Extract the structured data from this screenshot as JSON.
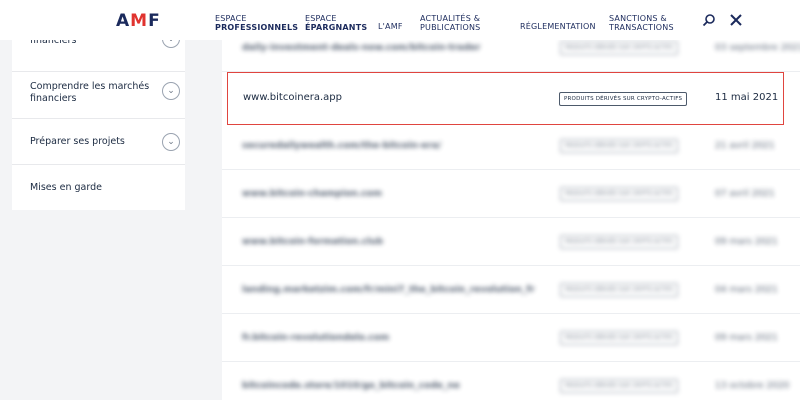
{
  "header": {
    "logo": "AMF",
    "nav": [
      {
        "line1": "ESPACE",
        "line2": "PROFESSIONNELS"
      },
      {
        "line1": "ESPACE",
        "line2": "ÉPARGNANTS"
      },
      {
        "line1": "L'AMF",
        "line2": ""
      },
      {
        "line1": "ACTUALITÉS &",
        "line2": "PUBLICATIONS"
      },
      {
        "line1": "RÉGLEMENTATION",
        "line2": ""
      },
      {
        "line1": "SANCTIONS &",
        "line2": "TRANSACTIONS"
      }
    ],
    "icons": [
      "search-icon",
      "close-icon"
    ]
  },
  "sidebar": {
    "items": [
      {
        "label": "financiers",
        "expandable": true
      },
      {
        "label": "Comprendre les marchés financiers",
        "expandable": true
      },
      {
        "label": "Préparer ses projets",
        "expandable": true
      },
      {
        "label": "Mises en garde",
        "expandable": false
      }
    ]
  },
  "list": {
    "highlighted": {
      "url": "www.bitcoinera.app",
      "tag": "PRODUITS DÉRIVÉS SUR CRYPTO-ACTIFS",
      "date": "11 mai 2021"
    },
    "rows": [
      {
        "url": "daily-investment-deals-now.com/bitcoin-trader",
        "tag": "PRODUITS DÉRIVÉS SUR CRYPTO-ACTIFS",
        "date": "03 septembre 2021"
      },
      {
        "url": "securedailywealth.com/the-bitcoin-era/",
        "tag": "PRODUITS DÉRIVÉS SUR CRYPTO-ACTIFS",
        "date": "21 avril 2021"
      },
      {
        "url": "www.bitcoin-champion.com",
        "tag": "PRODUITS DÉRIVÉS SUR CRYPTO-ACTIFS",
        "date": "07 avril 2021"
      },
      {
        "url": "www.bitcoin-formation.club",
        "tag": "PRODUITS DÉRIVÉS SUR CRYPTO-ACTIFS",
        "date": "09 mars 2021"
      },
      {
        "url": "landing.marketzim.com/fr/mini7_the_bitcoin_revolution_fr",
        "tag": "PRODUITS DÉRIVÉS SUR CRYPTO-ACTIFS",
        "date": "04 mars 2021"
      },
      {
        "url": "fr.bitcoin-revolutiondelo.com",
        "tag": "PRODUITS DÉRIVÉS SUR CRYPTO-ACTIFS",
        "date": "09 mars 2021"
      },
      {
        "url": "bitcoincode.store/1010/go_bitcoin_code_ne",
        "tag": "PRODUITS DÉRIVÉS SUR CRYPTO-ACTIFS",
        "date": "13 octobre 2020"
      }
    ]
  },
  "colors": {
    "accent": "#e0332f",
    "navy": "#1b2a5c",
    "highlight_border": "#e0453f"
  }
}
